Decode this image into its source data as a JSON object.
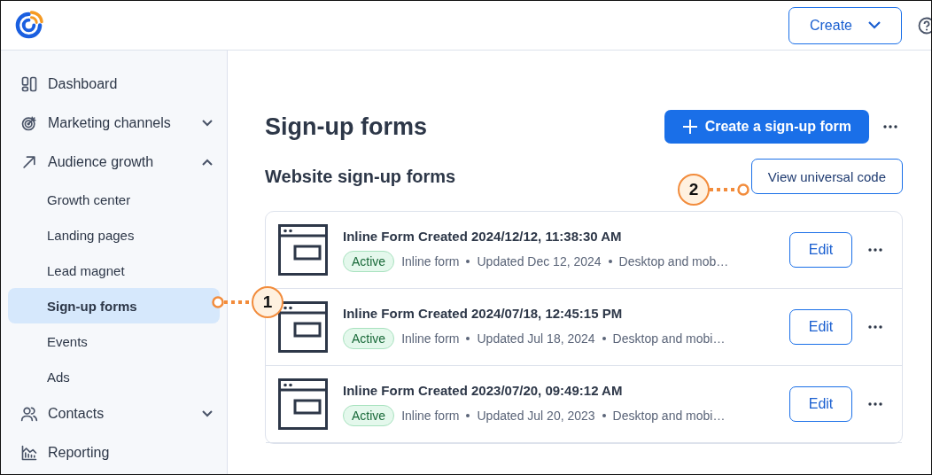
{
  "header": {
    "create_button": "Create"
  },
  "sidebar": {
    "items": [
      {
        "kind": "dashboard",
        "label": "Dashboard",
        "selected": false
      },
      {
        "kind": "target",
        "label": "Marketing channels",
        "selected": false,
        "expanded": false
      },
      {
        "kind": "arrow",
        "label": "Audience growth",
        "selected": false,
        "expanded": true,
        "children": [
          {
            "label": "Growth center",
            "selected": false
          },
          {
            "label": "Landing pages",
            "selected": false
          },
          {
            "label": "Lead magnet",
            "selected": false
          },
          {
            "label": "Sign-up forms",
            "selected": true
          },
          {
            "label": "Events",
            "selected": false
          },
          {
            "label": "Ads",
            "selected": false
          }
        ]
      },
      {
        "kind": "people",
        "label": "Contacts",
        "selected": false,
        "expanded": false
      },
      {
        "kind": "chart",
        "label": "Reporting",
        "selected": false
      }
    ]
  },
  "page": {
    "title": "Sign-up forms",
    "create_button": "Create a sign-up form",
    "section_title": "Website sign-up forms",
    "universal_code_button": "View universal code",
    "forms": [
      {
        "title": "Inline Form Created 2024/12/12, 11:38:30 AM",
        "status": "Active",
        "type": "Inline form",
        "updated": "Updated Dec 12, 2024",
        "devices": "Desktop and mob…",
        "edit": "Edit"
      },
      {
        "title": "Inline Form Created 2024/07/18, 12:45:15 PM",
        "status": "Active",
        "type": "Inline form",
        "updated": "Updated Jul 18, 2024",
        "devices": "Desktop and mobi…",
        "edit": "Edit"
      },
      {
        "title": "Inline Form Created 2023/07/20, 09:49:12 AM",
        "status": "Active",
        "type": "Inline form",
        "updated": "Updated Jul 20, 2023",
        "devices": "Desktop and mobi…",
        "edit": "Edit"
      }
    ]
  },
  "callouts": [
    {
      "number": "1"
    },
    {
      "number": "2"
    }
  ]
}
